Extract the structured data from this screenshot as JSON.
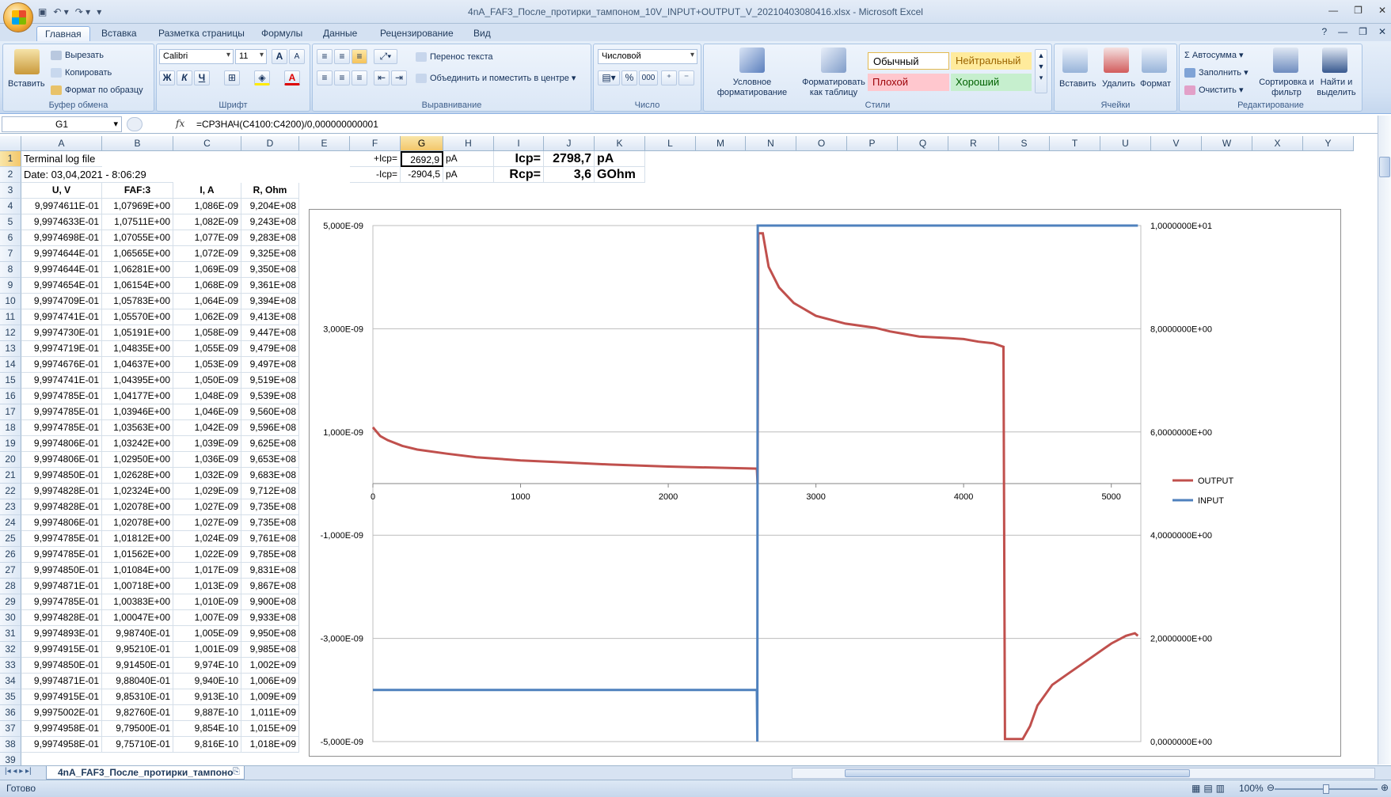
{
  "window": {
    "title": "4nA_FAF3_После_протирки_тампоном_10V_INPUT+OUTPUT_V_20210403080416.xlsx - Microsoft Excel"
  },
  "ribbon_tabs": [
    "Главная",
    "Вставка",
    "Разметка страницы",
    "Формулы",
    "Данные",
    "Рецензирование",
    "Вид"
  ],
  "ribbon": {
    "clipboard": {
      "paste": "Вставить",
      "cut": "Вырезать",
      "copy": "Копировать",
      "format_painter": "Формат по образцу",
      "label": "Буфер обмена"
    },
    "font": {
      "name": "Calibri",
      "size": "11",
      "bold": "Ж",
      "italic": "К",
      "underline": "Ч",
      "font_color_glyph": "A",
      "grow_glyph": "A",
      "shrink_glyph": "A",
      "label": "Шрифт"
    },
    "alignment": {
      "wrap": "Перенос текста",
      "merge": "Объединить и поместить в центре",
      "label": "Выравнивание"
    },
    "number": {
      "format": "Числовой",
      "percent": "%",
      "thousands": "000",
      "label": "Число"
    },
    "styles": {
      "conditional": "Условное форматирование",
      "as_table": "Форматировать как таблицу",
      "normal": "Обычный",
      "neutral": "Нейтральный",
      "bad": "Плохой",
      "good": "Хороший",
      "label": "Стили"
    },
    "cells": {
      "insert": "Вставить",
      "delete": "Удалить",
      "format": "Формат",
      "label": "Ячейки"
    },
    "editing": {
      "autosum": "Автосумма",
      "fill": "Заполнить",
      "clear": "Очистить",
      "sort": "Сортировка и фильтр",
      "find": "Найти и выделить",
      "label": "Редактирование"
    }
  },
  "formula_bar": {
    "name_box": "G1",
    "fx": "fx",
    "formula": "=СРЗНАЧ(C4100:C4200)/0,000000000001"
  },
  "columns": [
    "A",
    "B",
    "C",
    "D",
    "E",
    "F",
    "G",
    "H",
    "I",
    "J",
    "K",
    "L",
    "M",
    "N",
    "O",
    "P",
    "Q",
    "R",
    "S",
    "T",
    "U",
    "V",
    "W",
    "X",
    "Y"
  ],
  "selected_column": "G",
  "selected_row": 1,
  "sheet": {
    "A1": "Terminal log file",
    "A2": "Date: 03,04,2021 - 8:06:29",
    "headers": [
      "U, V",
      "FAF:3",
      "I, A",
      "R, Ohm"
    ],
    "F1": "+Icp=",
    "G1": "2692,9",
    "H1": "pA",
    "F2": "-Icp=",
    "G2": "-2904,5",
    "H2": "pA",
    "I1": "Icp=",
    "J1": "2798,7",
    "K1": "pA",
    "I2": "Rcp=",
    "J2": "3,6",
    "K2": "GOhm",
    "rows": [
      [
        "9,9974611E-01",
        "1,07969E+00",
        "1,086E-09",
        "9,204E+08"
      ],
      [
        "9,9974633E-01",
        "1,07511E+00",
        "1,082E-09",
        "9,243E+08"
      ],
      [
        "9,9974698E-01",
        "1,07055E+00",
        "1,077E-09",
        "9,283E+08"
      ],
      [
        "9,9974644E-01",
        "1,06565E+00",
        "1,072E-09",
        "9,325E+08"
      ],
      [
        "9,9974644E-01",
        "1,06281E+00",
        "1,069E-09",
        "9,350E+08"
      ],
      [
        "9,9974654E-01",
        "1,06154E+00",
        "1,068E-09",
        "9,361E+08"
      ],
      [
        "9,9974709E-01",
        "1,05783E+00",
        "1,064E-09",
        "9,394E+08"
      ],
      [
        "9,9974741E-01",
        "1,05570E+00",
        "1,062E-09",
        "9,413E+08"
      ],
      [
        "9,9974730E-01",
        "1,05191E+00",
        "1,058E-09",
        "9,447E+08"
      ],
      [
        "9,9974719E-01",
        "1,04835E+00",
        "1,055E-09",
        "9,479E+08"
      ],
      [
        "9,9974676E-01",
        "1,04637E+00",
        "1,053E-09",
        "9,497E+08"
      ],
      [
        "9,9974741E-01",
        "1,04395E+00",
        "1,050E-09",
        "9,519E+08"
      ],
      [
        "9,9974785E-01",
        "1,04177E+00",
        "1,048E-09",
        "9,539E+08"
      ],
      [
        "9,9974785E-01",
        "1,03946E+00",
        "1,046E-09",
        "9,560E+08"
      ],
      [
        "9,9974785E-01",
        "1,03563E+00",
        "1,042E-09",
        "9,596E+08"
      ],
      [
        "9,9974806E-01",
        "1,03242E+00",
        "1,039E-09",
        "9,625E+08"
      ],
      [
        "9,9974806E-01",
        "1,02950E+00",
        "1,036E-09",
        "9,653E+08"
      ],
      [
        "9,9974850E-01",
        "1,02628E+00",
        "1,032E-09",
        "9,683E+08"
      ],
      [
        "9,9974828E-01",
        "1,02324E+00",
        "1,029E-09",
        "9,712E+08"
      ],
      [
        "9,9974828E-01",
        "1,02078E+00",
        "1,027E-09",
        "9,735E+08"
      ],
      [
        "9,9974806E-01",
        "1,02078E+00",
        "1,027E-09",
        "9,735E+08"
      ],
      [
        "9,9974785E-01",
        "1,01812E+00",
        "1,024E-09",
        "9,761E+08"
      ],
      [
        "9,9974785E-01",
        "1,01562E+00",
        "1,022E-09",
        "9,785E+08"
      ],
      [
        "9,9974850E-01",
        "1,01084E+00",
        "1,017E-09",
        "9,831E+08"
      ],
      [
        "9,9974871E-01",
        "1,00718E+00",
        "1,013E-09",
        "9,867E+08"
      ],
      [
        "9,9974785E-01",
        "1,00383E+00",
        "1,010E-09",
        "9,900E+08"
      ],
      [
        "9,9974828E-01",
        "1,00047E+00",
        "1,007E-09",
        "9,933E+08"
      ],
      [
        "9,9974893E-01",
        "9,98740E-01",
        "1,005E-09",
        "9,950E+08"
      ],
      [
        "9,9974915E-01",
        "9,95210E-01",
        "1,001E-09",
        "9,985E+08"
      ],
      [
        "9,9974850E-01",
        "9,91450E-01",
        "9,974E-10",
        "1,002E+09"
      ],
      [
        "9,9974871E-01",
        "9,88040E-01",
        "9,940E-10",
        "1,006E+09"
      ],
      [
        "9,9974915E-01",
        "9,85310E-01",
        "9,913E-10",
        "1,009E+09"
      ],
      [
        "9,9975002E-01",
        "9,82760E-01",
        "9,887E-10",
        "1,011E+09"
      ],
      [
        "9,9974958E-01",
        "9,79500E-01",
        "9,854E-10",
        "1,015E+09"
      ],
      [
        "9,9974958E-01",
        "9,75710E-01",
        "9,816E-10",
        "1,018E+09"
      ]
    ]
  },
  "chart_data": {
    "type": "line",
    "x_ticks": [
      "0",
      "1000",
      "2000",
      "3000",
      "4000",
      "5000"
    ],
    "xlim": [
      0,
      5200
    ],
    "y_left_ticks": [
      "5,000E-09",
      "3,000E-09",
      "1,000E-09",
      "-1,000E-09",
      "-3,000E-09",
      "-5,000E-09"
    ],
    "y_left_lim": [
      -5e-09,
      5e-09
    ],
    "y_right_ticks": [
      "1,0000000E+01",
      "8,0000000E+00",
      "6,0000000E+00",
      "4,0000000E+00",
      "2,0000000E+00",
      "0,0000000E+00"
    ],
    "y_right_lim": [
      0,
      10
    ],
    "legend_position": "right",
    "series": [
      {
        "name": "OUTPUT",
        "axis": "left",
        "color": "#c0504d",
        "points": [
          [
            0,
            1.09e-09
          ],
          [
            50,
            9.2e-10
          ],
          [
            100,
            8.4e-10
          ],
          [
            200,
            7.3e-10
          ],
          [
            300,
            6.6e-10
          ],
          [
            500,
            5.8e-10
          ],
          [
            700,
            5.1e-10
          ],
          [
            1000,
            4.5e-10
          ],
          [
            1300,
            4.1e-10
          ],
          [
            1600,
            3.7e-10
          ],
          [
            2000,
            3.3e-10
          ],
          [
            2300,
            3.1e-10
          ],
          [
            2600,
            2.9e-10
          ],
          [
            2605,
            0
          ],
          [
            2610,
            4.85e-09
          ],
          [
            2640,
            4.85e-09
          ],
          [
            2680,
            4.2e-09
          ],
          [
            2750,
            3.8e-09
          ],
          [
            2850,
            3.5e-09
          ],
          [
            3000,
            3.25e-09
          ],
          [
            3200,
            3.1e-09
          ],
          [
            3400,
            3.02e-09
          ],
          [
            3500,
            2.95e-09
          ],
          [
            3700,
            2.85e-09
          ],
          [
            3900,
            2.82e-09
          ],
          [
            4000,
            2.8e-09
          ],
          [
            4100,
            2.75e-09
          ],
          [
            4200,
            2.72e-09
          ],
          [
            4270,
            2.65e-09
          ],
          [
            4280,
            -4.95e-09
          ],
          [
            4400,
            -4.95e-09
          ],
          [
            4450,
            -4.7e-09
          ],
          [
            4500,
            -4.3e-09
          ],
          [
            4600,
            -3.9e-09
          ],
          [
            4700,
            -3.7e-09
          ],
          [
            4800,
            -3.5e-09
          ],
          [
            4900,
            -3.3e-09
          ],
          [
            5000,
            -3.1e-09
          ],
          [
            5100,
            -2.95e-09
          ],
          [
            5160,
            -2.9e-09
          ],
          [
            5180,
            -2.95e-09
          ]
        ]
      },
      {
        "name": "INPUT",
        "axis": "right",
        "color": "#4f81bd",
        "points": [
          [
            0,
            1.0
          ],
          [
            2600,
            1.0
          ],
          [
            2603,
            0
          ],
          [
            2606,
            10.0
          ],
          [
            5180,
            10.0
          ]
        ]
      }
    ]
  },
  "sheet_tab": "4nA_FAF3_После_протирки_тампоно",
  "status": {
    "ready": "Готово",
    "zoom": "100%"
  }
}
